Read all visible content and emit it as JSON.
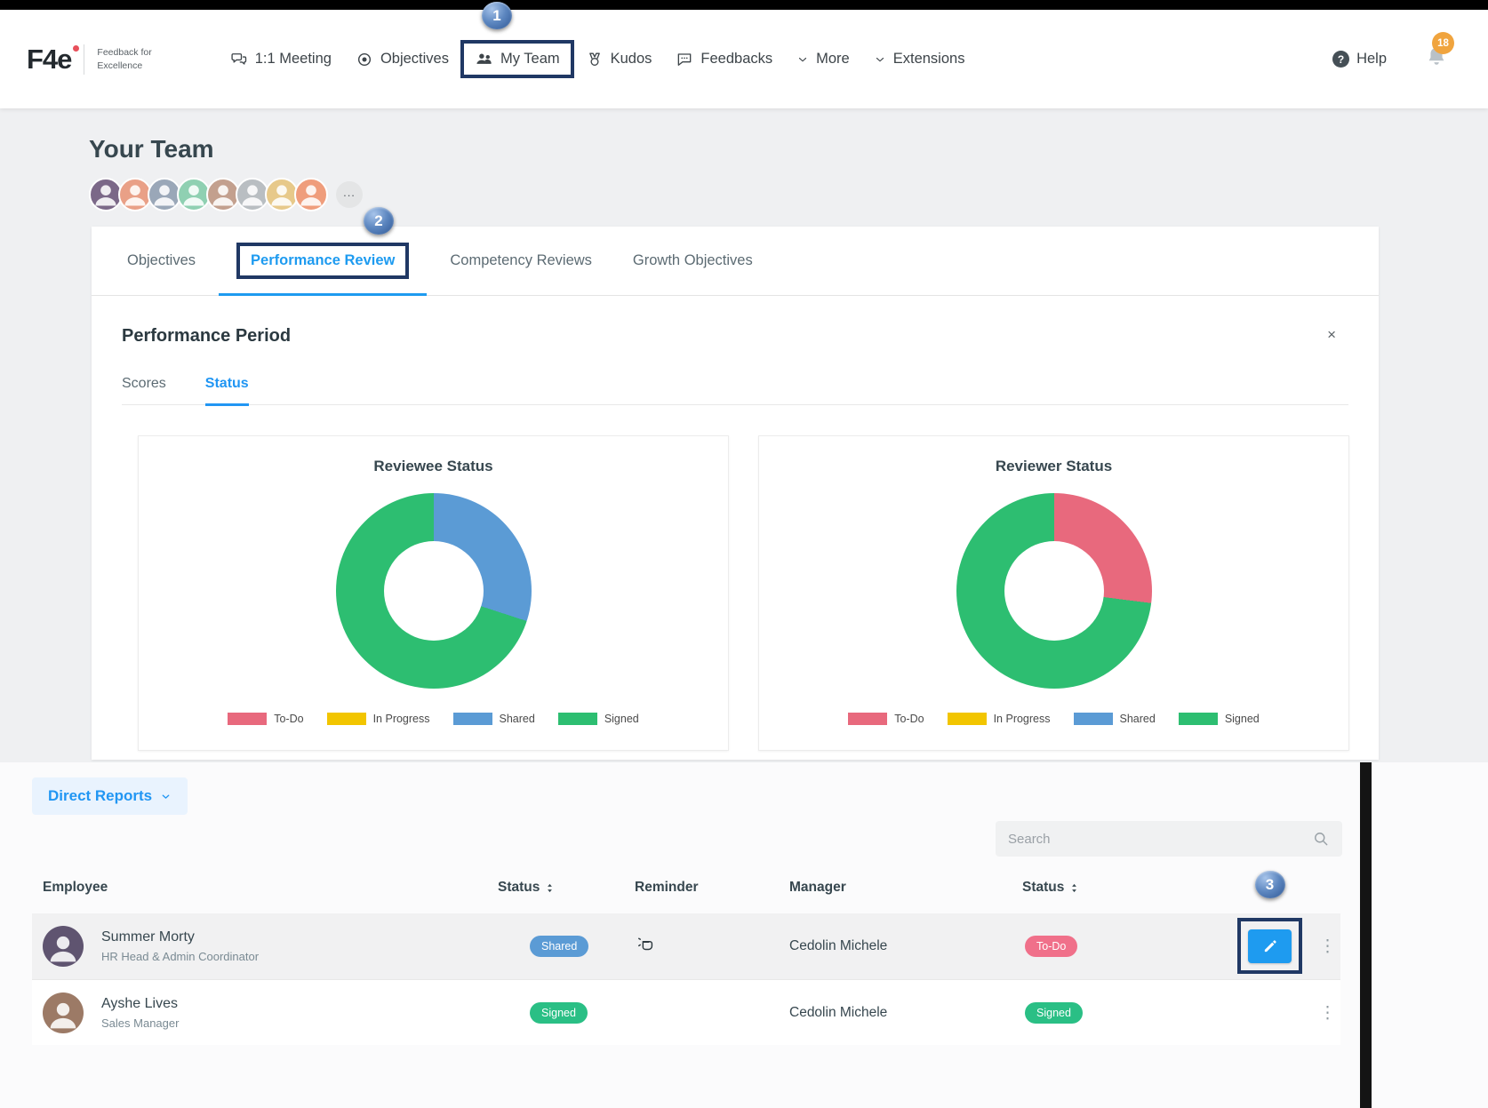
{
  "annotations": {
    "callout_1": "1",
    "callout_2": "2",
    "callout_3": "3"
  },
  "navbar": {
    "logo_text": "F4e",
    "tagline_line1": "Feedback for",
    "tagline_line2": "Excellence",
    "meeting": "1:1 Meeting",
    "objectives": "Objectives",
    "my_team": "My Team",
    "kudos": "Kudos",
    "feedbacks": "Feedbacks",
    "more": "More",
    "extensions": "Extensions",
    "help_label": "Help",
    "notification_count": "18"
  },
  "page": {
    "title": "Your Team",
    "avatars_overflow": "..."
  },
  "team_tabs": {
    "objectives": "Objectives",
    "performance_review": "Performance Review",
    "competency_reviews": "Competency Reviews",
    "growth_objectives": "Growth Objectives"
  },
  "panel": {
    "title": "Performance Period",
    "close_label": "×",
    "subtab_scores": "Scores",
    "subtab_status": "Status"
  },
  "chart_data": [
    {
      "type": "pie",
      "donut": true,
      "title": "Reviewee Status",
      "start_at": "top",
      "direction": "clockwise",
      "units": "percent",
      "segments": [
        {
          "label": "Shared",
          "color": "#5b9bd5",
          "percent": 30
        },
        {
          "label": "Signed",
          "color": "#2dbe71",
          "percent": 70
        }
      ],
      "legend": [
        {
          "label": "To-Do",
          "color": "#e8697d"
        },
        {
          "label": "In Progress",
          "color": "#f2c500"
        },
        {
          "label": "Shared",
          "color": "#5b9bd5"
        },
        {
          "label": "Signed",
          "color": "#2dbe71"
        }
      ],
      "legend_position": "bottom"
    },
    {
      "type": "pie",
      "donut": true,
      "title": "Reviewer Status",
      "start_at": "top",
      "direction": "clockwise",
      "units": "percent",
      "segments": [
        {
          "label": "To-Do",
          "color": "#e8697d",
          "percent": 27
        },
        {
          "label": "Signed",
          "color": "#2dbe71",
          "percent": 73
        }
      ],
      "legend": [
        {
          "label": "To-Do",
          "color": "#e8697d"
        },
        {
          "label": "In Progress",
          "color": "#f2c500"
        },
        {
          "label": "Shared",
          "color": "#5b9bd5"
        },
        {
          "label": "Signed",
          "color": "#2dbe71"
        }
      ],
      "legend_position": "bottom"
    }
  ],
  "reports": {
    "filter_label": "Direct Reports",
    "search_placeholder": "Search",
    "row_menu_icon": "⋮",
    "columns": {
      "employee": "Employee",
      "status": "Status",
      "reminder": "Reminder",
      "manager": "Manager",
      "status2": "Status"
    },
    "rows": [
      {
        "name": "Summer Morty",
        "title": "HR Head & Admin Coordinator",
        "status_reviewee": "Shared",
        "status_reviewee_key": "shared",
        "reminder": true,
        "manager": "Cedolin Michele",
        "status_reviewer": "To-Do",
        "status_reviewer_key": "todo"
      },
      {
        "name": "Ayshe Lives",
        "title": "Sales Manager",
        "status_reviewee": "Signed",
        "status_reviewee_key": "signed",
        "reminder": false,
        "manager": "Cedolin Michele",
        "status_reviewer": "Signed",
        "status_reviewer_key": "signed"
      }
    ]
  },
  "colors": {
    "accent_blue": "#1e9bf0",
    "badge_shared": "#5b9bd5",
    "badge_signed": "#2abf85",
    "badge_todo": "#f0708a",
    "annotation_navy": "#203864",
    "notification_badge": "#f0a43e"
  }
}
